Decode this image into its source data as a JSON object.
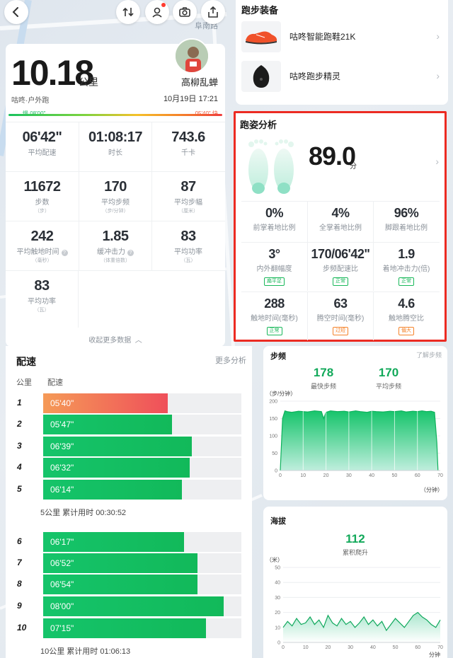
{
  "map": {
    "street_name": "阜南路"
  },
  "summary": {
    "distance": "10.18",
    "distance_unit": "公里",
    "username": "高柳乱蝉",
    "activity_type": "咕咚·户外跑",
    "datetime": "10月19日 17:21",
    "pace_slow_label": "慢 08'00\"",
    "pace_fast_label": "05'40\" 快",
    "stats": [
      [
        {
          "value": "06'42\"",
          "label": "平均配速"
        },
        {
          "value": "01:08:17",
          "label": "时长"
        },
        {
          "value": "743.6",
          "label": "千卡"
        }
      ],
      [
        {
          "value": "11672",
          "label": "步数",
          "sub": "（步）"
        },
        {
          "value": "170",
          "label": "平均步频",
          "sub": "（步/分钟）"
        },
        {
          "value": "87",
          "label": "平均步幅",
          "sub": "（厘米）"
        }
      ],
      [
        {
          "value": "242",
          "label": "平均触地时间",
          "sub": "（毫秒）",
          "info": true
        },
        {
          "value": "1.85",
          "label": "缓冲击力",
          "sub": "（体重倍数）",
          "info": true
        },
        {
          "value": "83",
          "label": "平均功率",
          "sub": "（瓦）"
        }
      ],
      [
        {
          "value": "83",
          "label": "平均功率",
          "sub": "（瓦）"
        }
      ]
    ],
    "collapse_label": "收起更多数据"
  },
  "gear": {
    "title": "跑步装备",
    "items": [
      {
        "name": "咕咚智能跑鞋21K",
        "icon": "shoe-icon"
      },
      {
        "name": "咕咚跑步精灵",
        "icon": "sensor-icon"
      }
    ]
  },
  "gait": {
    "title": "跑姿分析",
    "score": "89.0",
    "score_unit": "分",
    "rows": [
      [
        {
          "value": "0%",
          "label": "前掌着地比例"
        },
        {
          "value": "4%",
          "label": "全掌着地比例"
        },
        {
          "value": "96%",
          "label": "脚跟着地比例"
        }
      ],
      [
        {
          "value": "3°",
          "label": "内外翻幅度",
          "tag": "扁平足",
          "tag_color": "green"
        },
        {
          "value": "170/06'42\"",
          "label": "步频配速比",
          "tag": "正常",
          "tag_color": "green"
        },
        {
          "value": "1.9",
          "label": "着地冲击力(倍)",
          "tag": "正常",
          "tag_color": "green"
        }
      ],
      [
        {
          "value": "288",
          "label": "触地时间(毫秒)",
          "tag": "正常",
          "tag_color": "green"
        },
        {
          "value": "63",
          "label": "腾空时间(毫秒)",
          "tag": "过短",
          "tag_color": "orange"
        },
        {
          "value": "4.6",
          "label": "触地腾空比",
          "tag": "偏大",
          "tag_color": "orange"
        }
      ]
    ],
    "colors": {
      "highlight_border": "#ec2b22",
      "tag_green": "#19b85a",
      "tag_orange": "#f5832a"
    }
  },
  "pace": {
    "title": "配速",
    "more_label": "更多分析",
    "col_km": "公里",
    "col_pace": "配速",
    "splits": [
      {
        "km": "1",
        "pace": "05'40\"",
        "fraction": 0.63,
        "fastest": true
      },
      {
        "km": "2",
        "pace": "05'47\"",
        "fraction": 0.65
      },
      {
        "km": "3",
        "pace": "06'39\"",
        "fraction": 0.75
      },
      {
        "km": "4",
        "pace": "06'32\"",
        "fraction": 0.74
      },
      {
        "km": "5",
        "pace": "06'14\"",
        "fraction": 0.7
      },
      {
        "km": "6",
        "pace": "06'17\"",
        "fraction": 0.71
      },
      {
        "km": "7",
        "pace": "06'52\"",
        "fraction": 0.78
      },
      {
        "km": "8",
        "pace": "06'54\"",
        "fraction": 0.78
      },
      {
        "km": "9",
        "pace": "08'00\"",
        "fraction": 0.91
      },
      {
        "km": "10",
        "pace": "07'15\"",
        "fraction": 0.82
      }
    ],
    "note_5km": "5公里 累计用时 00:30:52",
    "note_10km": "10公里 累计用时 01:06:13"
  },
  "cadence": {
    "title": "步频",
    "link": "了解步频",
    "max_value": "178",
    "max_label": "最快步频",
    "avg_value": "170",
    "avg_label": "平均步频",
    "y_unit": "（步/分钟）",
    "x_unit": "（分钟）",
    "chart_data": {
      "type": "area",
      "x": [
        0,
        1,
        2,
        3,
        5,
        8,
        10,
        12,
        15,
        18,
        19,
        20,
        22,
        25,
        28,
        30,
        33,
        35,
        38,
        40,
        42,
        45,
        48,
        50,
        53,
        55,
        58,
        60,
        62,
        64,
        66,
        67.5,
        68.5,
        69
      ],
      "y": [
        0,
        150,
        172,
        170,
        168,
        171,
        170,
        169,
        172,
        170,
        150,
        168,
        172,
        170,
        171,
        169,
        172,
        170,
        168,
        171,
        170,
        169,
        171,
        170,
        172,
        169,
        171,
        170,
        172,
        170,
        171,
        168,
        80,
        0
      ],
      "xlim": [
        0,
        70
      ],
      "ylim": [
        0,
        200
      ],
      "xticks": [
        0,
        10,
        20,
        30,
        40,
        50,
        60,
        70
      ],
      "yticks": [
        0,
        50,
        100,
        150,
        200
      ],
      "grid": true
    }
  },
  "altitude": {
    "title": "海拔",
    "total_value": "112",
    "total_label": "累积爬升",
    "y_unit": "（米）",
    "x_unit": "分钟",
    "chart_data": {
      "type": "area",
      "x": [
        0,
        2,
        4,
        6,
        8,
        10,
        12,
        14,
        16,
        18,
        20,
        22,
        24,
        26,
        28,
        30,
        32,
        34,
        36,
        38,
        40,
        42,
        44,
        46,
        48,
        50,
        52,
        54,
        56,
        58,
        60,
        62,
        64,
        66,
        68,
        70
      ],
      "y": [
        10,
        14,
        11,
        16,
        12,
        13,
        17,
        12,
        15,
        10,
        18,
        13,
        11,
        16,
        12,
        14,
        10,
        13,
        17,
        12,
        15,
        11,
        14,
        8,
        12,
        16,
        13,
        10,
        14,
        18,
        20,
        17,
        15,
        12,
        10,
        15
      ],
      "xlim": [
        0,
        70
      ],
      "ylim": [
        0,
        50
      ],
      "xticks": [
        0,
        10,
        20,
        30,
        40,
        50,
        60,
        70
      ],
      "yticks": [
        0,
        10,
        20,
        30,
        40,
        50
      ],
      "grid": true
    }
  },
  "colors": {
    "brand_green": "#12b95a",
    "fast_red": "#ef4f5a",
    "fast_orange": "#f59a57"
  }
}
